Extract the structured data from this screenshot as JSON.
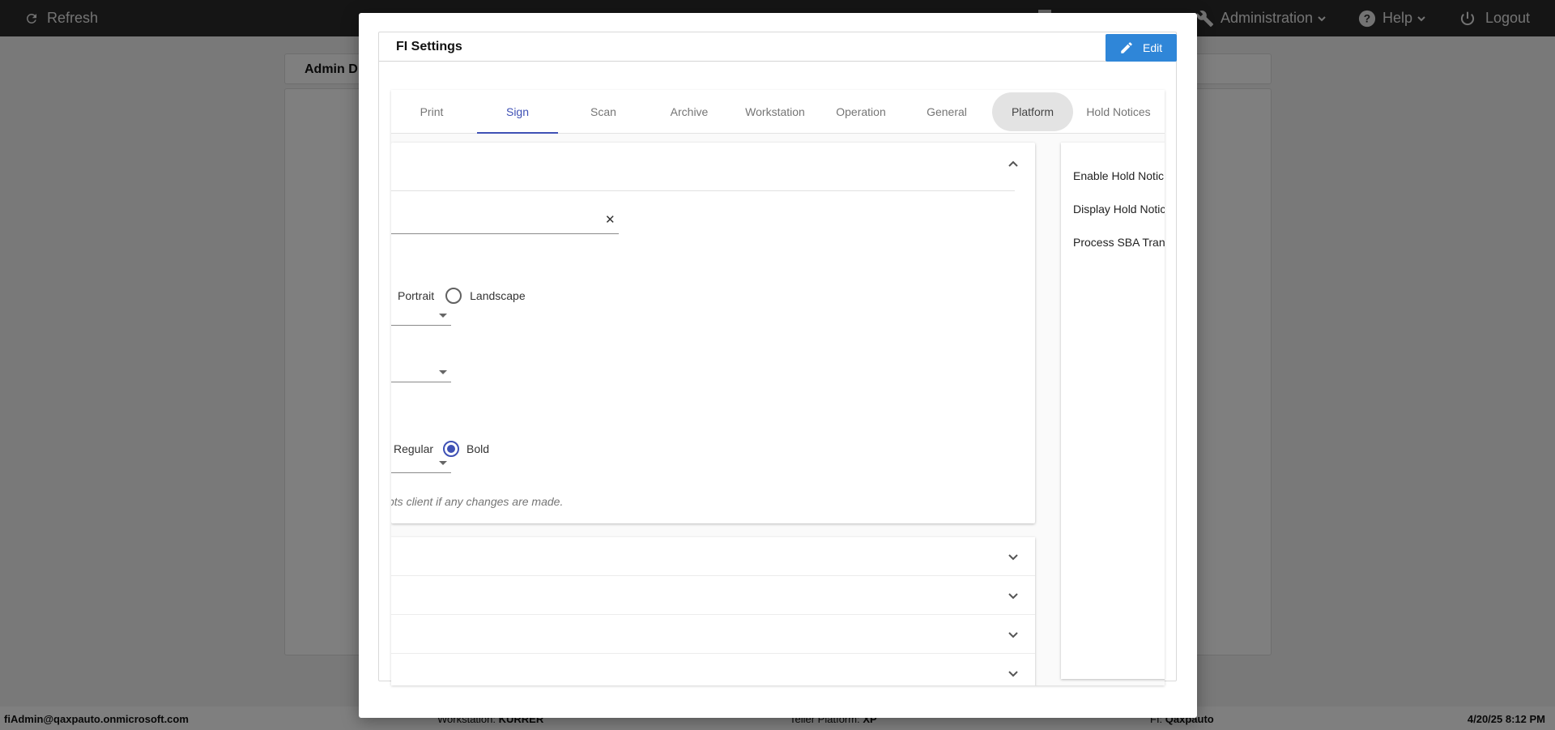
{
  "topbar": {
    "refresh_label": "Refresh",
    "administration_label": "Administration",
    "help_label": "Help",
    "logout_label": "Logout"
  },
  "background": {
    "admin_card_title": "Admin D"
  },
  "footer": {
    "user": "fiAdmin@qaxpauto.onmicrosoft.com",
    "workstation_label": "Workstation: ",
    "workstation_value": "KURRER",
    "teller_platform_label": "Teller Platform: ",
    "teller_platform_value": "XP",
    "fi_label": "FI: ",
    "fi_value": "Qaxpauto",
    "datetime": "4/20/25 8:12 PM"
  },
  "modal": {
    "title": "FI Settings",
    "edit_label": "Edit",
    "tabs": [
      {
        "label": "Print"
      },
      {
        "label": "Sign"
      },
      {
        "label": "Scan"
      },
      {
        "label": "Archive"
      },
      {
        "label": "Workstation"
      },
      {
        "label": "Operation"
      },
      {
        "label": "General"
      },
      {
        "label": "Platform"
      },
      {
        "label": "Hold Notices"
      }
    ],
    "active_tab": "Sign",
    "hovered_tab": "Platform",
    "sign_panel": {
      "clear_symbol": "✕",
      "orientation_options": [
        {
          "label": "Portrait"
        },
        {
          "label": "Landscape",
          "selected": false
        }
      ],
      "font_weight_options": [
        {
          "label": "Regular"
        },
        {
          "label": "Bold",
          "selected": true
        }
      ],
      "note": "pts client if any changes are made."
    },
    "right_panel": {
      "items": [
        {
          "label": "Enable Hold Notic"
        },
        {
          "label": "Display Hold Notic"
        },
        {
          "label": "Process SBA Tran"
        }
      ]
    }
  },
  "colors": {
    "accent": "#3f51b5",
    "edit_button": "#2f86d8",
    "topbar": "#2b2b2b"
  }
}
